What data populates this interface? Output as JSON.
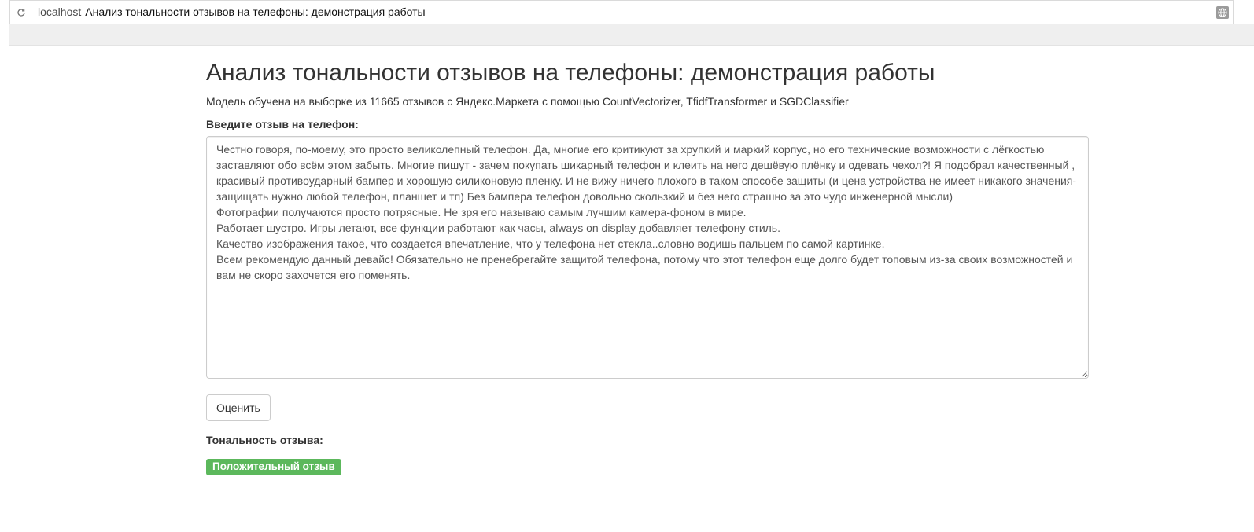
{
  "browser": {
    "host": "localhost",
    "page_title": "Анализ тональности отзывов на телефоны: демонстрация работы",
    "icons": {
      "reload": "reload-icon",
      "site_info": "globe-icon"
    }
  },
  "page": {
    "heading": "Анализ тональности отзывов на телефоны: демонстрация работы",
    "description": "Модель обучена на выборке из 11665 отзывов с Яндекс.Маркета с помощью CountVectorizer, TfidfTransformer и SGDClassifier",
    "form": {
      "review_label": "Введите отзыв на телефон:",
      "review_text": "Честно говоря, по-моему, это просто великолепный телефон. Да, многие его критикуют за хрупкий и маркий корпус, но его технические возможности с лёгкостью заставляют обо всём этом забыть. Многие пишут - зачем покупать шикарный телефон и клеить на него дешёвую плёнку и одевать чехол?! Я подобрал качественный , красивый противоударный бампер и хорошую силиконовую пленку. И не вижу ничего плохого в таком способе защиты (и цена устройства не имеет никакого значения-защищать нужно любой телефон, планшет и тп) Без бампера телефон довольно скользкий и без него страшно за это чудо инженерной мысли)\nФотографии получаются просто потрясные. Не зря его называю самым лучшим камера-фоном в мире.\nРаботает шустро. Игры летают, все функции работают как часы, always on display добавляет телефону стиль.\nКачество изображения такое, что создается впечатление, что у телефона нет стекла..словно водишь пальцем по самой картинке.\nВсем рекомендую данный девайс! Обязательно не пренебрегайте защитой телефона, потому что этот телефон еще долго будет топовым из-за своих возможностей и вам не скоро захочется его поменять.",
      "submit_label": "Оценить"
    },
    "result": {
      "heading": "Тональность отзыва:",
      "sentiment": "Положительный отзыв"
    }
  },
  "colors": {
    "sentiment_badge": "#5cb85c",
    "toolbar_background": "#efefef"
  }
}
